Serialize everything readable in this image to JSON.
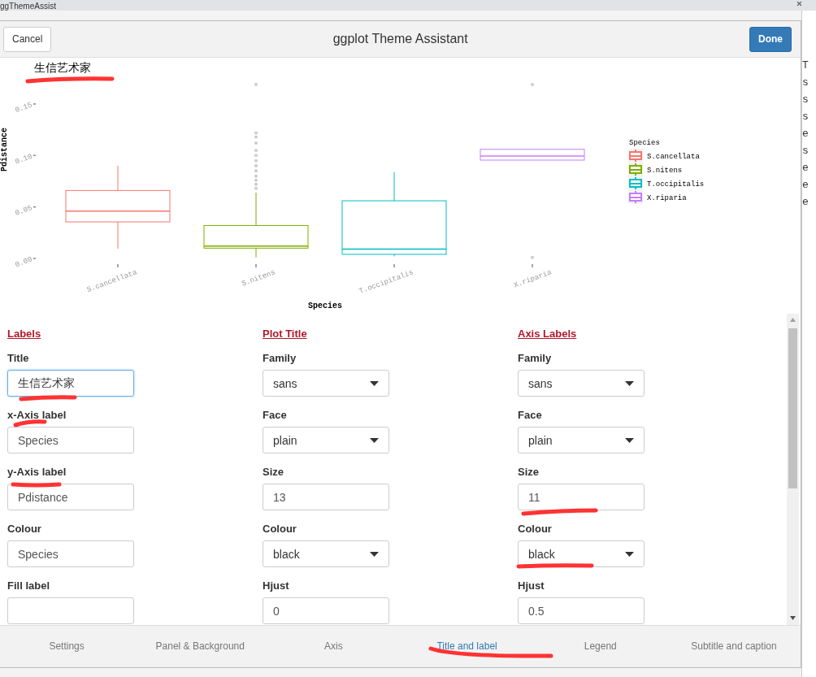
{
  "window": {
    "title": "ggThemeAssist"
  },
  "dialog": {
    "title": "ggplot Theme Assistant",
    "cancel": "Cancel",
    "done": "Done"
  },
  "plot": {
    "title": "生信艺术家",
    "xlabel": "Species",
    "ylabel": "Pdistance",
    "yticks": [
      "0.00",
      "0.05",
      "0.10",
      "0.15"
    ],
    "categories": [
      "S.cancellata",
      "S.nitens",
      "T.occipitalis",
      "X.riparia"
    ],
    "legend": {
      "title": "Species",
      "items": [
        {
          "label": "S.cancellata",
          "color": "#f8766d"
        },
        {
          "label": "S.nitens",
          "color": "#7cae00"
        },
        {
          "label": "T.occipitalis",
          "color": "#00bfc4"
        },
        {
          "label": "X.riparia",
          "color": "#c77cff"
        }
      ]
    }
  },
  "sections": [
    {
      "heading": "Labels",
      "fields": [
        {
          "label": "Title",
          "kind": "text",
          "value": "生信艺术家",
          "focused": true
        },
        {
          "label": "x-Axis label",
          "kind": "text",
          "value": "Species",
          "focused": false
        },
        {
          "label": "y-Axis label",
          "kind": "text",
          "value": "Pdistance",
          "focused": false
        },
        {
          "label": "Colour",
          "kind": "text",
          "value": "Species",
          "focused": false
        },
        {
          "label": "Fill label",
          "kind": "text",
          "focused": false
        }
      ]
    },
    {
      "heading": "Plot Title",
      "fields": [
        {
          "label": "Family",
          "kind": "select",
          "value": "sans",
          "focused": false
        },
        {
          "label": "Face",
          "kind": "select",
          "value": "plain",
          "focused": false
        },
        {
          "label": "Size",
          "kind": "text",
          "value": "13",
          "focused": false
        },
        {
          "label": "Colour",
          "kind": "select",
          "value": "black",
          "focused": false
        },
        {
          "label": "Hjust",
          "kind": "text",
          "value": "0",
          "focused": false
        }
      ]
    },
    {
      "heading": "Axis Labels",
      "fields": [
        {
          "label": "Family",
          "kind": "select",
          "value": "sans",
          "focused": false
        },
        {
          "label": "Face",
          "kind": "select",
          "value": "plain",
          "focused": false
        },
        {
          "label": "Size",
          "kind": "text",
          "value": "11",
          "focused": false
        },
        {
          "label": "Colour",
          "kind": "select",
          "value": "black",
          "focused": false
        },
        {
          "label": "Hjust",
          "kind": "text",
          "value": "0.5",
          "focused": false
        }
      ]
    }
  ],
  "tabs": [
    {
      "label": "Settings",
      "selected": false
    },
    {
      "label": "Panel & Background",
      "selected": false
    },
    {
      "label": "Axis",
      "selected": false
    },
    {
      "label": "Title and label",
      "selected": true
    },
    {
      "label": "Legend",
      "selected": false
    },
    {
      "label": "Subtitle and caption",
      "selected": false
    }
  ],
  "editor_fragments": [
    "T",
    "s",
    "s",
    "s",
    "e",
    "s",
    "e",
    "e",
    "e"
  ]
}
